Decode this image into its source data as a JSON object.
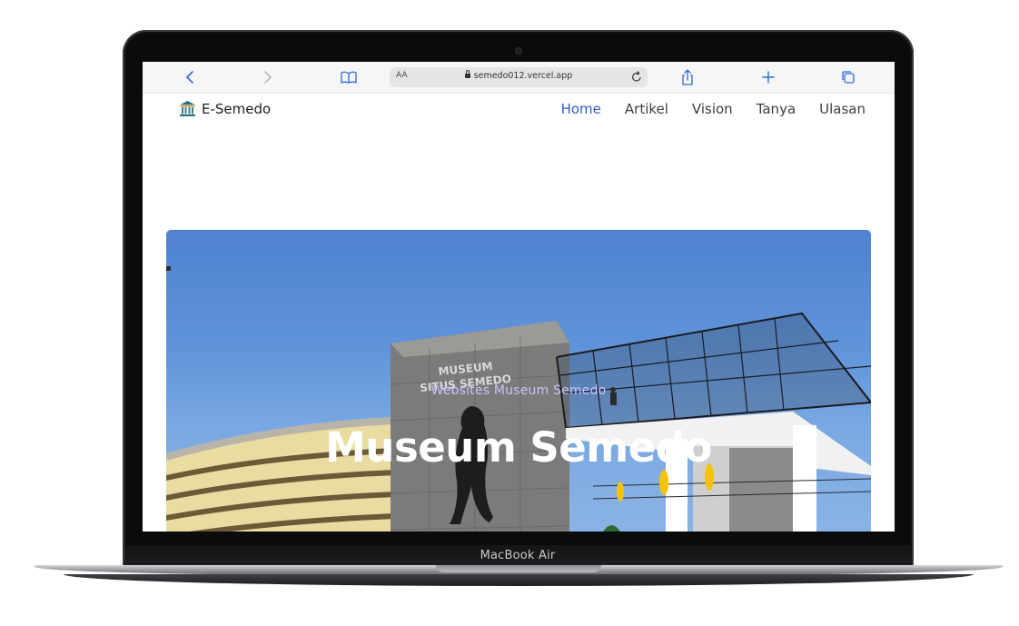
{
  "device": {
    "label": "MacBook Air"
  },
  "browser": {
    "url": "semedo012.vercel.app",
    "reader_label": "AA",
    "icons": [
      "chevron-left-icon",
      "chevron-right-icon",
      "book-icon",
      "lock-icon",
      "reload-icon",
      "share-icon",
      "plus-icon",
      "tabs-icon"
    ]
  },
  "site": {
    "brand": "E-Semedo",
    "brand_icon": "museum-icon",
    "nav": [
      {
        "label": "Home",
        "active": true
      },
      {
        "label": "Artikel",
        "active": false
      },
      {
        "label": "Vision",
        "active": false
      },
      {
        "label": "Tanya",
        "active": false
      },
      {
        "label": "Ulasan",
        "active": false
      }
    ],
    "accent_color": "#2f5bd3"
  },
  "hero": {
    "subtitle": "Websites Museum Semedo",
    "title": "Museum Semedo",
    "building_sign": [
      "MUSEUM",
      "SITUS SEMEDO"
    ]
  }
}
